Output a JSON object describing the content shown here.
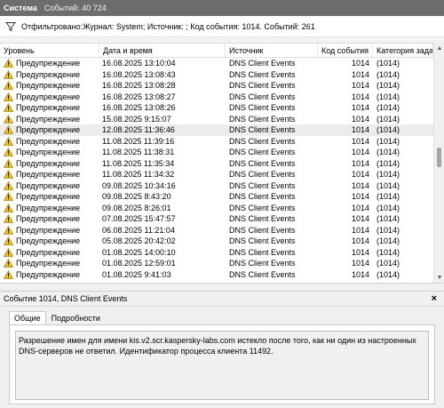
{
  "window": {
    "title": "Система",
    "event_count": "Событий: 40 724"
  },
  "filter": {
    "text": "Отфильтровано:Журнал: System; Источник: ; Код события: 1014. Событий: 261"
  },
  "columns": [
    "Уровень",
    "Дата и время",
    "Источник",
    "Код события",
    "Категория задачи"
  ],
  "rows": [
    {
      "level": "Предупреждение",
      "date": "16.08.2025 13:10:04",
      "source": "DNS Client Events",
      "id": "1014",
      "cat": "(1014)"
    },
    {
      "level": "Предупреждение",
      "date": "16.08.2025 13:08:43",
      "source": "DNS Client Events",
      "id": "1014",
      "cat": "(1014)"
    },
    {
      "level": "Предупреждение",
      "date": "16.08.2025 13:08:28",
      "source": "DNS Client Events",
      "id": "1014",
      "cat": "(1014)"
    },
    {
      "level": "Предупреждение",
      "date": "16.08.2025 13:08:27",
      "source": "DNS Client Events",
      "id": "1014",
      "cat": "(1014)"
    },
    {
      "level": "Предупреждение",
      "date": "16.08.2025 13:08:26",
      "source": "DNS Client Events",
      "id": "1014",
      "cat": "(1014)"
    },
    {
      "level": "Предупреждение",
      "date": "15.08.2025 9:15:07",
      "source": "DNS Client Events",
      "id": "1014",
      "cat": "(1014)"
    },
    {
      "level": "Предупреждение",
      "date": "12.08.2025 11:36:46",
      "source": "DNS Client Events",
      "id": "1014",
      "cat": "(1014)",
      "selected": true
    },
    {
      "level": "Предупреждение",
      "date": "11.08.2025 11:39:16",
      "source": "DNS Client Events",
      "id": "1014",
      "cat": "(1014)"
    },
    {
      "level": "Предупреждение",
      "date": "11.08.2025 11:38:31",
      "source": "DNS Client Events",
      "id": "1014",
      "cat": "(1014)"
    },
    {
      "level": "Предупреждение",
      "date": "11.08.2025 11:35:34",
      "source": "DNS Client Events",
      "id": "1014",
      "cat": "(1014)"
    },
    {
      "level": "Предупреждение",
      "date": "11.08.2025 11:34:32",
      "source": "DNS Client Events",
      "id": "1014",
      "cat": "(1014)"
    },
    {
      "level": "Предупреждение",
      "date": "09.08.2025 10:34:16",
      "source": "DNS Client Events",
      "id": "1014",
      "cat": "(1014)"
    },
    {
      "level": "Предупреждение",
      "date": "09.08.2025 8:43:20",
      "source": "DNS Client Events",
      "id": "1014",
      "cat": "(1014)"
    },
    {
      "level": "Предупреждение",
      "date": "09.08.2025 8:26:01",
      "source": "DNS Client Events",
      "id": "1014",
      "cat": "(1014)"
    },
    {
      "level": "Предупреждение",
      "date": "07.08.2025 15:47:57",
      "source": "DNS Client Events",
      "id": "1014",
      "cat": "(1014)"
    },
    {
      "level": "Предупреждение",
      "date": "06.08.2025 11:21:04",
      "source": "DNS Client Events",
      "id": "1014",
      "cat": "(1014)"
    },
    {
      "level": "Предупреждение",
      "date": "05.08.2025 20:42:02",
      "source": "DNS Client Events",
      "id": "1014",
      "cat": "(1014)"
    },
    {
      "level": "Предупреждение",
      "date": "01.08.2025 14:00:10",
      "source": "DNS Client Events",
      "id": "1014",
      "cat": "(1014)"
    },
    {
      "level": "Предупреждение",
      "date": "01.08.2025 12:59:01",
      "source": "DNS Client Events",
      "id": "1014",
      "cat": "(1014)"
    },
    {
      "level": "Предупреждение",
      "date": "01.08.2025 9:41:03",
      "source": "DNS Client Events",
      "id": "1014",
      "cat": "(1014)"
    }
  ],
  "details": {
    "title": "Событие 1014, DNS Client Events",
    "close": "×",
    "tabs": [
      "Общие",
      "Подробности"
    ],
    "active_tab": 0,
    "message": "Разрешение имен для имени kis.v2.scr.kaspersky-labs.com истекло после того, как ни один из настроенных DNS-серверов не ответил. Идентификатор процесса клиента 11492."
  },
  "icons": {
    "warning": "warning-icon",
    "filter": "funnel-icon",
    "close": "close-icon"
  },
  "colors": {
    "titlebar_bg": "#6d6d6d",
    "warning_fill": "#f2c500",
    "selected_row": "#ececec"
  }
}
